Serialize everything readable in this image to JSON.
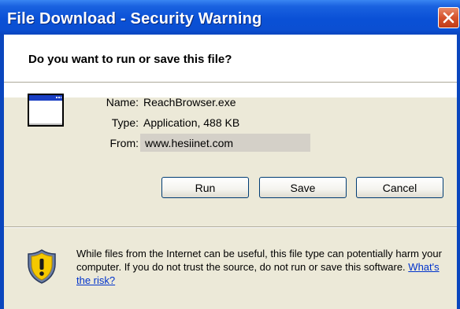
{
  "window": {
    "title": "File Download - Security Warning"
  },
  "dialog": {
    "question": "Do you want to run or save this file?",
    "file": {
      "name_label": "Name:",
      "name_value": "ReachBrowser.exe",
      "type_label": "Type:",
      "type_value": "Application, 488 KB",
      "from_label": "From:",
      "from_value": "www.hesiinet.com"
    },
    "buttons": {
      "run": "Run",
      "save": "Save",
      "cancel": "Cancel"
    },
    "warning": {
      "text": "While files from the Internet can be useful, this file type can potentially harm your computer. If you do not trust the source, do not run or save this software.",
      "link": "What's the risk?"
    }
  },
  "icons": {
    "close": "close-icon",
    "app": "application-window-icon",
    "warning": "security-shield-icon"
  },
  "colors": {
    "titlebar": "#0a50d6",
    "close_button": "#d5522c",
    "dialog_background": "#ece9d8",
    "link": "#0033cc"
  }
}
